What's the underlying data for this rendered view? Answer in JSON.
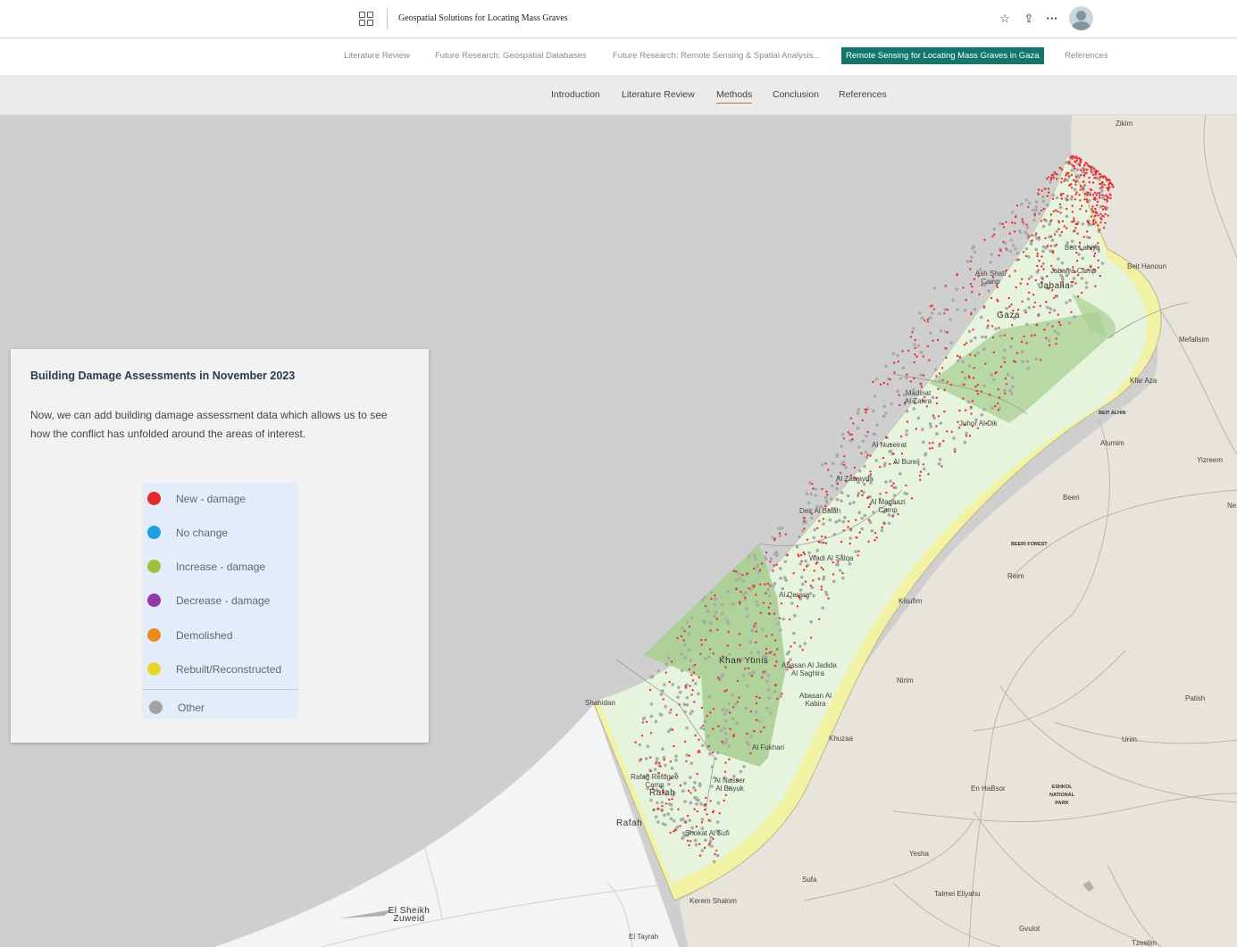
{
  "header": {
    "story_title": "Geospatial Solutions for Locating Mass Graves",
    "icons": [
      "apps-grid-icon",
      "star-icon",
      "share-icon",
      "more-icon",
      "avatar-icon"
    ]
  },
  "collection_nav": {
    "items": [
      {
        "label": "Literature Review"
      },
      {
        "label": "Future Research: Geospatial Databases"
      },
      {
        "label": "Future Research: Remote Sensing & Spatial Analysis..."
      },
      {
        "label": "Remote Sensing for Locating Mass Graves in Gaza",
        "active": true
      },
      {
        "label": "References"
      }
    ]
  },
  "section_nav": {
    "items": [
      {
        "label": "Introduction"
      },
      {
        "label": "Literature Review"
      },
      {
        "label": "Methods",
        "active": true
      },
      {
        "label": "Conclusion"
      },
      {
        "label": "References"
      }
    ]
  },
  "panel": {
    "heading": "Building Damage Assessments in November 2023",
    "body": "Now, we can add building damage assessment data which allows us to see how the conflict has unfolded around the areas of interest.",
    "legend": [
      {
        "label": "New - damage",
        "color": "#e02a2a"
      },
      {
        "label": "No change",
        "color": "#1aa0dc"
      },
      {
        "label": "Increase - damage",
        "color": "#9cc13a"
      },
      {
        "label": "Decrease - damage",
        "color": "#9439a6"
      },
      {
        "label": "Demolished",
        "color": "#ea8c1c"
      },
      {
        "label": "Rebuilt/Reconstructed",
        "color": "#e8d62a"
      },
      {
        "label": "Other",
        "color": "#a3a3a3"
      }
    ]
  },
  "map": {
    "colors": {
      "sea": "#cfcfcf",
      "land_israel": "#e7e4dc",
      "land_egypt": "#f4f4f4",
      "gaza_fill": "#e6f4dd",
      "agri": "#a8cf92",
      "coast_buffer": "#f1f2a4",
      "damage": "#e53232",
      "other": "#a9a9a9"
    },
    "labels": {
      "zikim": "Zikim",
      "beit_lahiya": "Beit Lahiya",
      "jabalya_camp": "Jabalya Camp",
      "beit_hanoun": "Beit Hanoun",
      "ash_shati_camp": "Ash Shati Camp",
      "jabalia": "Jabalia",
      "gaza": "Gaza",
      "mefallsim": "Mefallsim",
      "kfar_aza": "Kfar Aza",
      "beit_alhin": "BEIT ALHIN",
      "madinat_al_zahra": "Madinat Al Zahra",
      "juhor_al_dik": "Juhor Al Dik",
      "alumim": "Alumim",
      "al_nuseirat": "Al Nuseirat",
      "al_bureij": "Al Bureij",
      "yizreem": "Yizreem",
      "al_zawayda": "Al Zawayda",
      "beeri": "Beeri",
      "al_maghazi_camp": "Al Maghazi Camp",
      "deir_al_balah": "Deir Al Balah",
      "ne": "Ne",
      "beeri_forest": "BEERI FOREST",
      "wadi_al_salqa": "Wadi Al Salqa",
      "reim": "Reim",
      "al_qarara": "Al Qarara",
      "kisufim": "Kisufim",
      "khan_yunis": "Khan Yunis",
      "abasan_al_jadida": "Abasan Al Jadida",
      "abasan_al_saghira": "Al Saghira",
      "abasan_al_kabira": "Abasan Al Kabira",
      "nirim": "Nirim",
      "patish": "Patish",
      "shahidan": "Shahidan",
      "khuzaa": "Khuzaa",
      "al_fukhari": "Al Fukhari",
      "urim": "Urim",
      "rafah_refugee_camp": "Rafah Refugee Camp",
      "rafah_inner": "Rafah",
      "al_nasser": "Al Nasser Al Bayuk",
      "en_habsor": "En HaBsor",
      "eshkol_park": "ESHKOL NATIONAL PARK",
      "rafah": "Rafah",
      "shokat_al_sufi": "Shokat Al Sufi",
      "yesha": "Yesha",
      "sufa": "Sufa",
      "kerem_shalom": "Kerem Shalom",
      "talmei_eliyahu": "Talmei Eliyahu",
      "el_sheikh_zuweid": "El Sheikh Zuweid",
      "el_tayrah": "El Tayrah",
      "gvulot": "Gvulot",
      "tzeelim": "Tzeelim"
    }
  }
}
